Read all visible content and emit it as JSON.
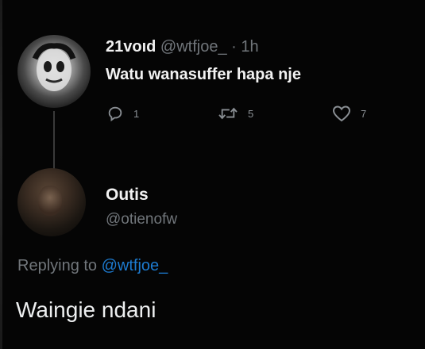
{
  "original_tweet": {
    "display_name": "21voıd",
    "handle": "@wtfjoe_",
    "separator": "·",
    "time": "1h",
    "text": "Watu wanasuffer hapa nje",
    "actions": {
      "reply_count": "1",
      "retweet_count": "5",
      "like_count": "7"
    }
  },
  "reply": {
    "display_name": "Outis",
    "handle": "@otienofw",
    "replying_to_label": "Replying to",
    "replying_to_handle": "@wtfjoe_",
    "text": "Waingie ndani"
  },
  "colors": {
    "background": "#000000",
    "primary_text": "#e7e9ea",
    "secondary_text": "#71767b",
    "mention": "#1d7bd0"
  },
  "icons": [
    "reply-icon",
    "retweet-icon",
    "like-icon"
  ]
}
